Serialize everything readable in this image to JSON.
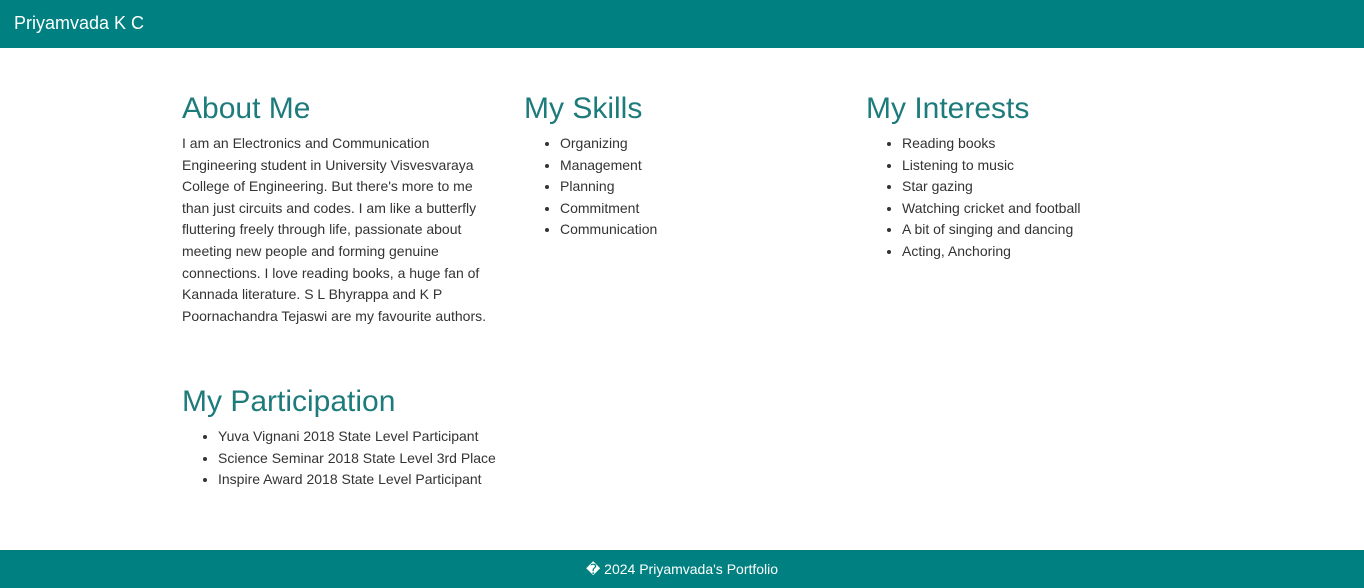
{
  "navbar": {
    "brand": "Priyamvada K C",
    "background": "#008080"
  },
  "about": {
    "heading": "About Me",
    "text": "I am an Electronics and Communication Engineering student in University Visvesvaraya College of Engineering. But there's more to me than just circuits and codes. I am like a butterfly fluttering freely through life, passionate about meeting new people and forming genuine connections. I love reading books, a huge fan of Kannada literature. S L Bhyrappa and K P Poornachandra Tejaswi are my favourite authors."
  },
  "skills": {
    "heading": "My Skills",
    "items": [
      "Organizing",
      "Management",
      "Planning",
      "Commitment",
      "Communication"
    ]
  },
  "interests": {
    "heading": "My Interests",
    "items": [
      "Reading books",
      "Listening to music",
      "Star gazing",
      "Watching cricket and football",
      "A bit of singing and dancing",
      "Acting, Anchoring"
    ]
  },
  "participation": {
    "heading": "My Participation",
    "items": [
      "Yuva Vignani 2018 State Level Participant",
      "Science Seminar 2018 State Level 3rd Place",
      "Inspire Award 2018 State Level Participant"
    ]
  },
  "footer": {
    "text": "� 2024 Priyamvada's Portfolio"
  },
  "colors": {
    "accent": "#008080",
    "heading": "#1e7b7b",
    "body_text": "#333333"
  }
}
